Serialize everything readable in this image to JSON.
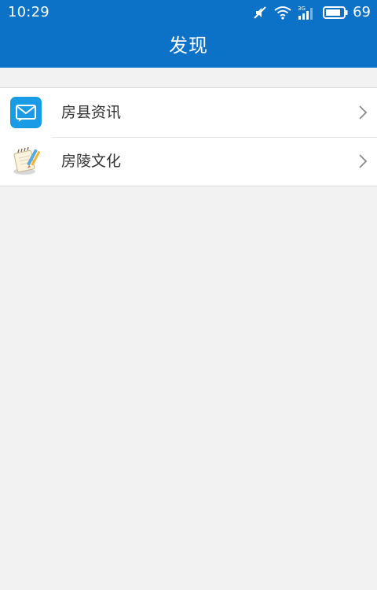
{
  "status_bar": {
    "time": "10:29",
    "icons": [
      "mute-icon",
      "wifi-icon",
      "signal-3g-icon",
      "battery-icon"
    ],
    "battery_level": "69"
  },
  "app_bar": {
    "title": "发现"
  },
  "list": {
    "items": [
      {
        "label": "房县资讯",
        "icon": "mail-icon"
      },
      {
        "label": "房陵文化",
        "icon": "notebook-icon"
      }
    ]
  },
  "colors": {
    "primary": "#0b72c8",
    "background": "#f2f2f2",
    "list_background": "#ffffff",
    "mail_icon": "#1a9be6",
    "text": "#333333",
    "chevron": "#8a8a8a"
  }
}
